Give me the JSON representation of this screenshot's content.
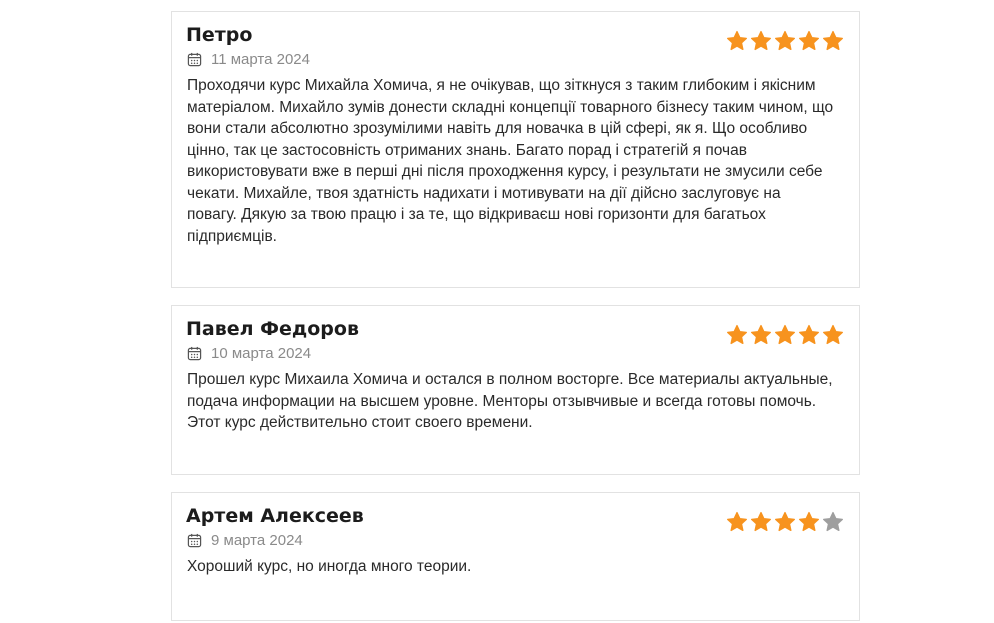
{
  "colors": {
    "star_filled": "#F7931E",
    "star_empty": "#9E9E9E",
    "border": "#E2E2E2",
    "date_text": "#8A8A8A"
  },
  "reviews": [
    {
      "name": "Петро",
      "date": "11 марта 2024",
      "rating": 5,
      "max_rating": 5,
      "text": "Проходячи курс Михайла Хомича, я не очікував, що зіткнуся з таким глибоким і якісним матеріалом. Михайло зумів донести складні концепції товарного бізнесу таким чином, що вони стали абсолютно зрозумілими навіть для новачка в цій сфері, як я. Що особливо цінно, так це застосовність отриманих знань. Багато порад і стратегій я почав використовувати вже в перші дні після проходження курсу, і результати не змусили себе чекати. Михайле, твоя здатність надихати і мотивувати на дії дійсно заслуговує на повагу. Дякую за твою працю і за те, що відкриваєш нові горизонти для багатьох підприємців."
    },
    {
      "name": "Павел Федоров",
      "date": "10 марта 2024",
      "rating": 5,
      "max_rating": 5,
      "text": "Прошел курс Михаила Хомича и остался в полном восторге. Все материалы актуальные, подача информации на высшем уровне. Менторы отзывчивые и всегда готовы помочь. Этот курс действительно стоит своего времени."
    },
    {
      "name": "Артем Алексеев",
      "date": "9 марта 2024",
      "rating": 4,
      "max_rating": 5,
      "text": "Хороший курс, но иногда много теории."
    }
  ],
  "icons": {
    "date": "calendar-icon",
    "rating": "star-icon"
  }
}
